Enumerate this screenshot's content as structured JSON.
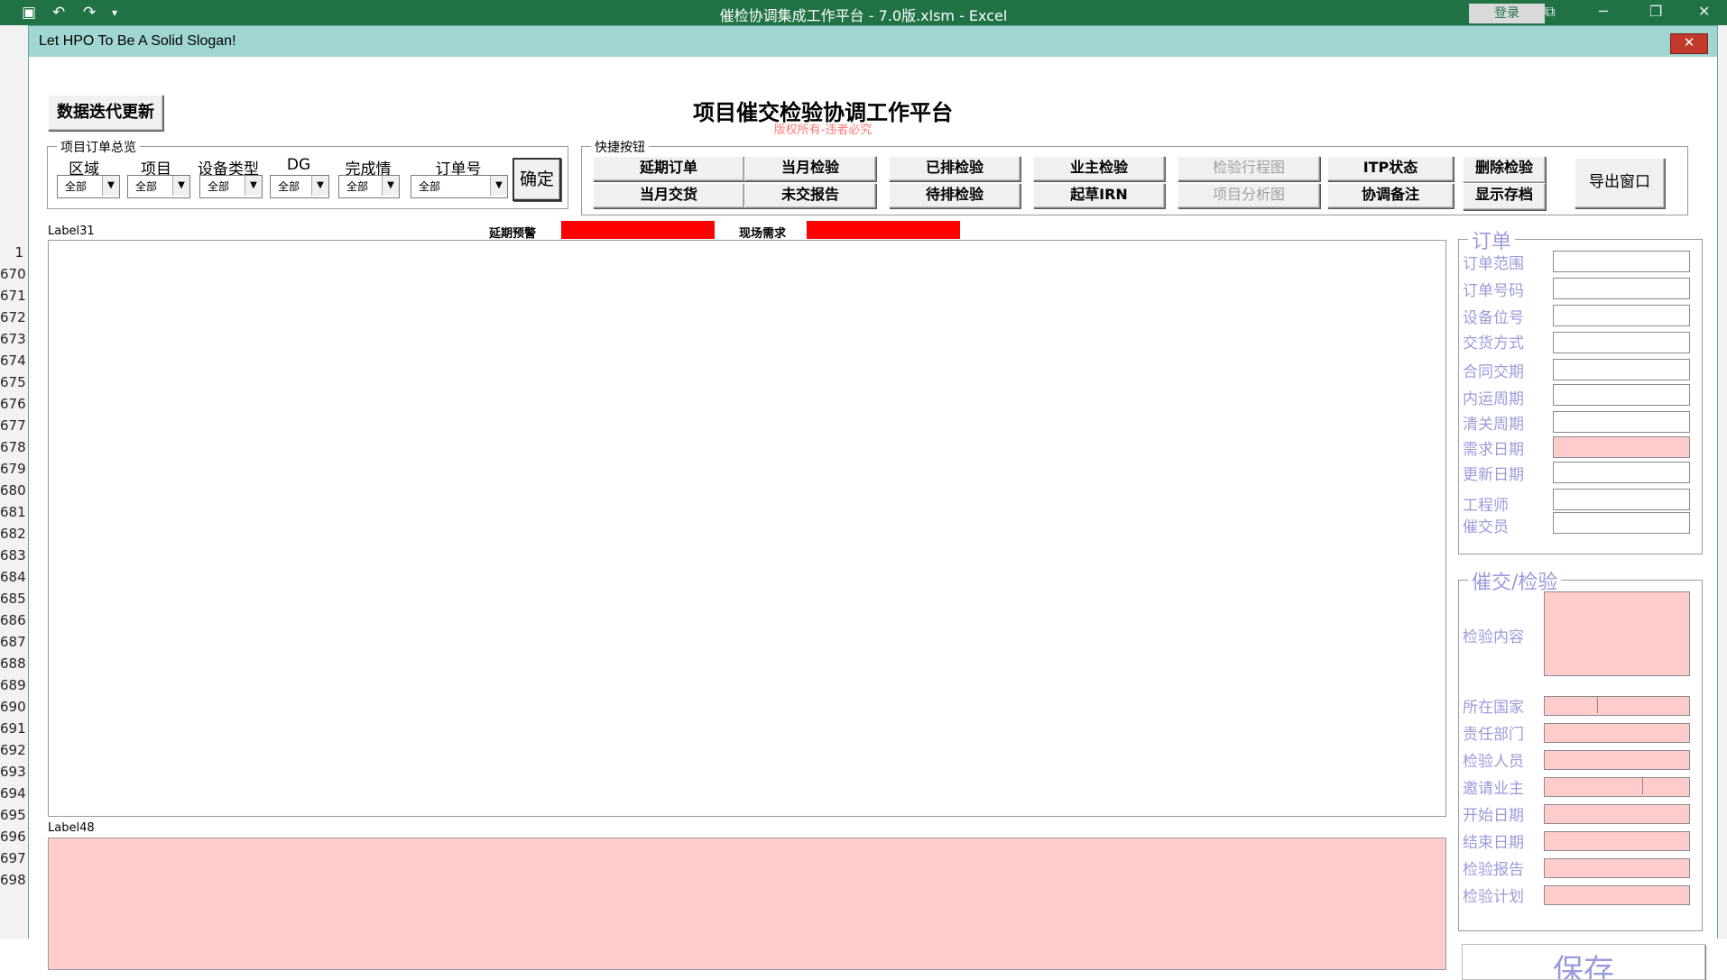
{
  "excel": {
    "title": "催检协调集成工作平台 - 7.0版.xlsm  -  Excel",
    "login": "登录",
    "row_numbers": [
      "1",
      "670",
      "671",
      "672",
      "673",
      "674",
      "675",
      "676",
      "677",
      "678",
      "679",
      "680",
      "681",
      "682",
      "683",
      "684",
      "685",
      "686",
      "687",
      "688",
      "689",
      "690",
      "691",
      "692",
      "693",
      "694",
      "695",
      "696",
      "697",
      "698"
    ]
  },
  "form": {
    "window_title": "Let HPO To Be A Solid Slogan!",
    "close_label": "✕",
    "update_button": "数据迭代更新",
    "main_title": "项目催交检验协调工作平台",
    "copyright": "版权所有-违者必究",
    "overview": {
      "legend": "项目订单总览",
      "filters": [
        {
          "label": "区域",
          "value": "全部"
        },
        {
          "label": "项目",
          "value": "全部"
        },
        {
          "label": "设备类型",
          "value": "全部"
        },
        {
          "label": "DG",
          "value": "全部"
        },
        {
          "label": "完成情",
          "value": "全部"
        },
        {
          "label": "订单号",
          "value": "全部"
        }
      ],
      "confirm": "确定"
    },
    "quick": {
      "legend": "快捷按钮",
      "row1": [
        "延期订单",
        "当月检验",
        "已排检验",
        "业主检验",
        "检验行程图",
        "ITP状态"
      ],
      "row2": [
        "当月交货",
        "未交报告",
        "待排检验",
        "起草IRN",
        "项目分析图",
        "协调备注"
      ],
      "delete_insp": "删除检验",
      "show_archive": "显示存档",
      "export_window": "导出窗口"
    },
    "label31": "Label31",
    "delay_warning": "延期预警",
    "site_demand": "现场需求",
    "label48": "Label48",
    "order_panel": {
      "legend": "订单",
      "fields": [
        "订单范围",
        "订单号码",
        "设备位号",
        "交货方式",
        "合同交期",
        "内运周期",
        "清关周期",
        "需求日期",
        "更新日期",
        "工程师",
        "催交员"
      ]
    },
    "insp_panel": {
      "legend": "催交/检验",
      "fields": [
        "检验内容",
        "所在国家",
        "责任部门",
        "检验人员",
        "邀请业主",
        "开始日期",
        "结束日期",
        "检验报告",
        "检验计划"
      ]
    },
    "save": "保存"
  }
}
